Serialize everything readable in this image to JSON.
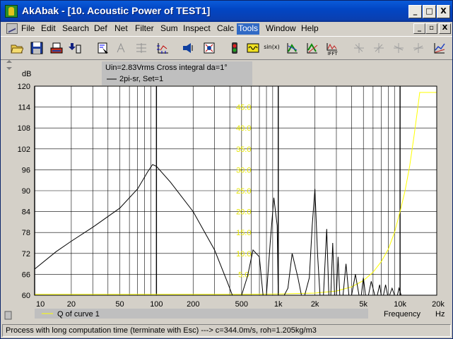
{
  "window": {
    "title": "AkAbak - [10. Acoustic Power of TEST1]",
    "min_label": "_",
    "max_label": "□",
    "close_label": "X"
  },
  "menu": {
    "items": [
      "File",
      "Edit",
      "Search",
      "Def",
      "Net",
      "Filter",
      "Sum",
      "Inspect",
      "Calc",
      "Tools",
      "Window",
      "Help"
    ],
    "active": "Tools",
    "mdi_min": "_",
    "mdi_restore": "▫",
    "mdi_close": "X"
  },
  "toolbar": {
    "tools": [
      {
        "icon": "open-folder-icon",
        "enabled": true
      },
      {
        "icon": "save-disk-icon",
        "enabled": true
      },
      {
        "icon": "print-icon",
        "enabled": true
      },
      {
        "icon": "export-icon",
        "enabled": true
      },
      {
        "icon": "edit-script-icon",
        "enabled": true
      },
      {
        "icon": "cursor-icon",
        "enabled": false
      },
      {
        "icon": "scale-icon",
        "enabled": false
      },
      {
        "icon": "axes-icon",
        "enabled": true
      },
      {
        "icon": "speaker-icon",
        "enabled": true
      },
      {
        "icon": "acoustic-icon",
        "enabled": true
      },
      {
        "icon": "meter-icon",
        "enabled": true
      },
      {
        "icon": "signal-icon",
        "enabled": true
      },
      {
        "icon": "sine-icon",
        "enabled": true,
        "text": "sin(x)"
      },
      {
        "icon": "curve-icon",
        "enabled": true
      },
      {
        "icon": "multi-curve-icon",
        "enabled": true
      },
      {
        "icon": "ifft-icon",
        "enabled": true,
        "text": "IFFT"
      },
      {
        "icon": "view1-icon",
        "enabled": false
      },
      {
        "icon": "view2-icon",
        "enabled": false
      },
      {
        "icon": "view3-icon",
        "enabled": false
      },
      {
        "icon": "view4-icon",
        "enabled": false
      },
      {
        "icon": "chart-icon",
        "enabled": true
      }
    ]
  },
  "plot": {
    "info_line1": "Uin=2.83Vrms Cross integral da=1°",
    "info_line2": "2pi-sr, Set=1",
    "y_unit": "dB",
    "freq_label": "Frequency",
    "freq_unit": "Hz",
    "legend_label": "Q of curve 1",
    "colors": {
      "main": "#000000",
      "q": "#ffff00",
      "grid": "#000000",
      "bg": "#ffffff"
    }
  },
  "chart_data": {
    "type": "line",
    "title": "",
    "xlabel": "Frequency",
    "ylabel": "dB",
    "x_scale": "log",
    "xlim": [
      10,
      20000
    ],
    "ylim": [
      60,
      120
    ],
    "x_tick_labels": [
      "10",
      "20",
      "50",
      "100",
      "200",
      "500",
      "1k",
      "2k",
      "5k",
      "10k",
      "20k"
    ],
    "x_tick_values": [
      10,
      20,
      50,
      100,
      200,
      500,
      1000,
      2000,
      5000,
      10000,
      20000
    ],
    "y_ticks": [
      60,
      66,
      72,
      78,
      84,
      90,
      96,
      102,
      108,
      114,
      120
    ],
    "y2_ticks": [
      5.0,
      10.0,
      15.0,
      20.0,
      25.0,
      30.0,
      35.0,
      40.0,
      45.0
    ],
    "y2_lim": [
      0,
      50
    ],
    "grid": true,
    "series": [
      {
        "name": "",
        "axis": "left",
        "x": [
          10,
          15,
          20,
          30,
          50,
          70,
          85,
          93,
          100,
          130,
          200,
          300,
          380,
          420,
          460,
          500,
          560,
          620,
          700,
          750,
          800,
          860,
          920,
          980,
          1000,
          1050,
          1120,
          1200,
          1300,
          1450,
          1550,
          1650,
          1800,
          1900,
          2000,
          2100,
          2200,
          2350,
          2500,
          2600,
          2700,
          2800,
          2900,
          3000,
          3100,
          3200,
          3400,
          3600,
          3800,
          4000,
          4300,
          4600,
          4800,
          5000,
          5200,
          5500,
          5800,
          6200,
          6500,
          6800,
          7000,
          7300,
          7600,
          7900,
          8200,
          8600,
          9000,
          9500,
          9800,
          10200
        ],
        "y": [
          67.5,
          72.5,
          75.5,
          79.5,
          85,
          90.5,
          95.5,
          97.5,
          97,
          92.5,
          84,
          73,
          64,
          60,
          60,
          60,
          65.5,
          73,
          71,
          60,
          60,
          75.5,
          88,
          80,
          60,
          60,
          60,
          62,
          72,
          65,
          60,
          60,
          65,
          80,
          90.5,
          72,
          60,
          60,
          79,
          60,
          60,
          75,
          60,
          60,
          71,
          60,
          60,
          69,
          60,
          60,
          66,
          60,
          60,
          65,
          60,
          60,
          64,
          60,
          60,
          63,
          60,
          60,
          63,
          60,
          60,
          62,
          60,
          60,
          62,
          60
        ]
      },
      {
        "name": "Q of curve 1",
        "axis": "right",
        "x": [
          10,
          20,
          50,
          100,
          200,
          500,
          1000,
          2000,
          3000,
          4000,
          5000,
          6000,
          7000,
          8000,
          9000,
          10000,
          11000,
          12000,
          13000,
          14000,
          14500,
          20000
        ],
        "y": [
          0.2,
          0.2,
          0.2,
          0.2,
          0.2,
          0.2,
          0.3,
          0.5,
          1.0,
          2.0,
          3.5,
          5.5,
          8.0,
          11.0,
          15.0,
          20.0,
          25.0,
          31.0,
          38.0,
          45.0,
          48.5,
          48.5
        ]
      }
    ]
  },
  "status": {
    "text": "Process with long computation time (terminate with Esc) ---> c=344.0m/s, roh=1.205kg/m3"
  }
}
